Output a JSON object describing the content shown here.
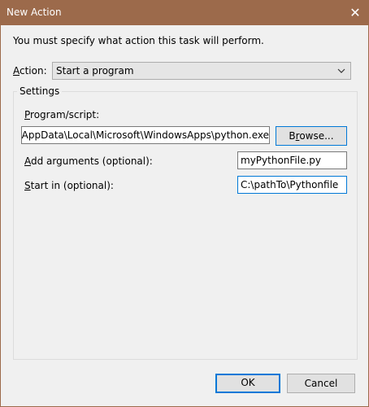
{
  "window": {
    "title": "New Action",
    "close_glyph": "✕"
  },
  "instruction": "You must specify what action this task will perform.",
  "action": {
    "label_pre": "",
    "label_u": "A",
    "label_post": "ction:",
    "selected": "Start a program"
  },
  "settings": {
    "group_label": "Settings",
    "program": {
      "label_pre": "",
      "label_u": "P",
      "label_post": "rogram/script:",
      "value": "ony\\AppData\\Local\\Microsoft\\WindowsApps\\python.exe"
    },
    "browse": {
      "label_pre": "B",
      "label_u": "r",
      "label_post": "owse..."
    },
    "arguments": {
      "label_pre": "",
      "label_u": "A",
      "label_post": "dd arguments (optional):",
      "value": "myPythonFile.py"
    },
    "start_in": {
      "label_pre": "",
      "label_u": "S",
      "label_post": "tart in (optional):",
      "value": "C:\\pathTo\\Pythonfile"
    }
  },
  "buttons": {
    "ok": "OK",
    "cancel": "Cancel"
  },
  "colors": {
    "titlebar": "#9c6a4b",
    "accent": "#0078d7"
  }
}
